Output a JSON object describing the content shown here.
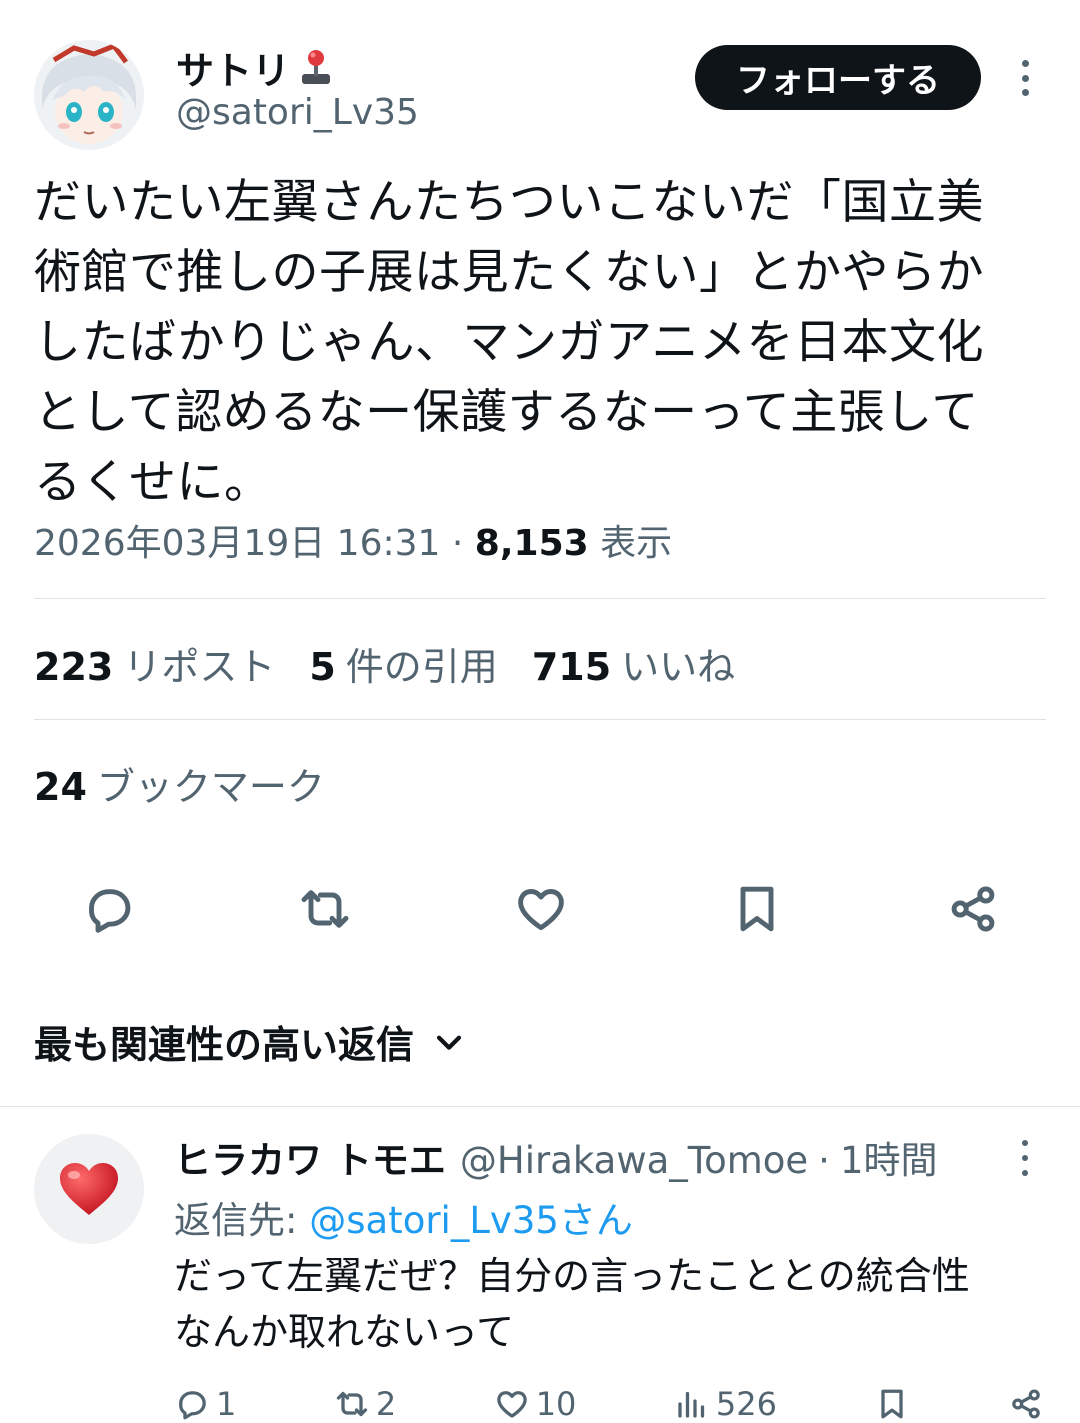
{
  "author": {
    "display_name": "サトリ",
    "name_emoji": "🕹️",
    "handle": "@satori_Lv35",
    "avatar_icon": "anime-avatar"
  },
  "follow_button": "フォローする",
  "tweet": {
    "text": "だいたい左翼さんたちついこないだ「国立美\n術館で推しの子展は見たくない」とかやらか\nしたばかりじゃん、マンガアニメを日本文化\nとして認めるなー保護するなーって主張して\nるくせに。",
    "timestamp": "2026年03月19日 16:31",
    "separator": "·",
    "views_count": "8,153",
    "views_label": "表示"
  },
  "stats": {
    "reposts_count": "223",
    "reposts_label": "リポスト",
    "quotes_count": "5",
    "quotes_label": "件の引用",
    "likes_count": "715",
    "likes_label": "いいね",
    "bookmarks_count": "24",
    "bookmarks_label": "ブックマーク"
  },
  "actions": [
    "reply-icon",
    "repost-icon",
    "like-icon",
    "bookmark-icon",
    "share-icon"
  ],
  "replies_sort_label": "最も関連性の高い返信",
  "reply": {
    "display_name": "ヒラカワ トモエ",
    "handle": "@Hirakawa_Tomoe",
    "separator": "·",
    "time": "1時間",
    "replying_to_label": "返信先: ",
    "replying_to_handle": "@satori_Lv35さん",
    "text": "だって左翼だぜ？自分の言ったこととの統合性\nなんか取れないって",
    "reply_count": "1",
    "repost_count": "2",
    "like_count": "10",
    "view_count": "526",
    "avatar_icon": "heart-emoji"
  },
  "colors": {
    "text": "#0f1419",
    "muted": "#536471",
    "link": "#1d9bf0",
    "follow_bg": "#0f1419",
    "divider": "#dfe3e6"
  }
}
